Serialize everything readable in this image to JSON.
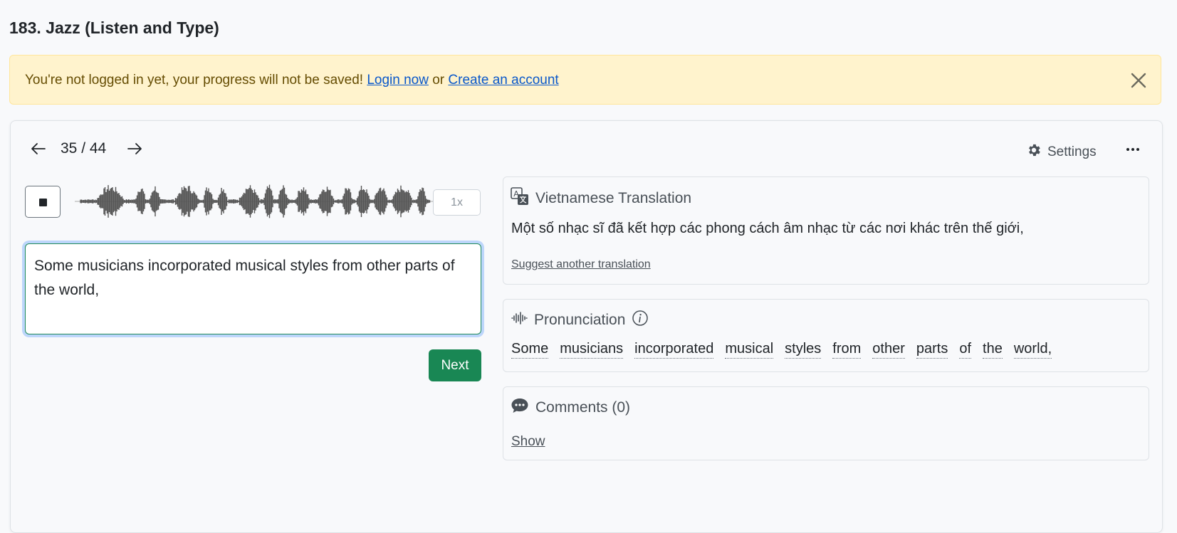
{
  "page": {
    "title": "183. Jazz (Listen and Type)"
  },
  "alert": {
    "message": "You're not logged in yet, your progress will not be saved!",
    "login_link": "Login now",
    "or_text": "or",
    "create_link": "Create an account",
    "close_icon": "close-icon"
  },
  "exercise": {
    "counter": "35 / 44",
    "prev_icon": "arrow-left-icon",
    "next_icon": "arrow-right-icon",
    "settings_label": "Settings",
    "settings_icon": "gear-icon",
    "more_icon": "more-horizontal-icon"
  },
  "player": {
    "stop_icon": "stop-icon",
    "speed": "1x"
  },
  "answer": {
    "value": "Some musicians incorporated musical styles from other parts of the world,"
  },
  "next_button": "Next",
  "translation": {
    "icon": "translate-icon",
    "title": "Vietnamese Translation",
    "text": "Một số nhạc sĩ đã kết hợp các phong cách âm nhạc từ các nơi khác trên thế giới,",
    "suggest_link": "Suggest another translation"
  },
  "pronunciation": {
    "icon": "soundwave-icon",
    "title": "Pronunciation",
    "info_icon": "info-icon",
    "words": [
      "Some",
      "musicians",
      "incorporated",
      "musical",
      "styles",
      "from",
      "other",
      "parts",
      "of",
      "the",
      "world,"
    ]
  },
  "comments": {
    "icon": "chat-icon",
    "title": "Comments (0)",
    "show_link": "Show"
  },
  "colors": {
    "primary_green": "#198754",
    "alert_bg": "#fff3cd",
    "link": "#0a58ca"
  }
}
